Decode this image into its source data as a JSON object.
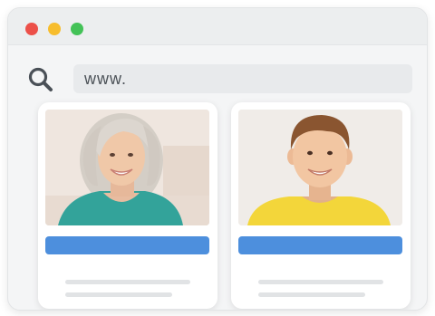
{
  "browser": {
    "traffic_lights": [
      {
        "name": "close",
        "color": "#ec5049"
      },
      {
        "name": "minimize",
        "color": "#f7bd2d"
      },
      {
        "name": "maximize",
        "color": "#43c257"
      }
    ],
    "search_icon": "search-icon",
    "url": "www."
  },
  "cards": [
    {
      "photo": "woman-with-gray-hair-avatar",
      "button_color": "#4d8fdd"
    },
    {
      "photo": "boy-in-yellow-shirt-avatar",
      "button_color": "#4d8fdd"
    }
  ]
}
